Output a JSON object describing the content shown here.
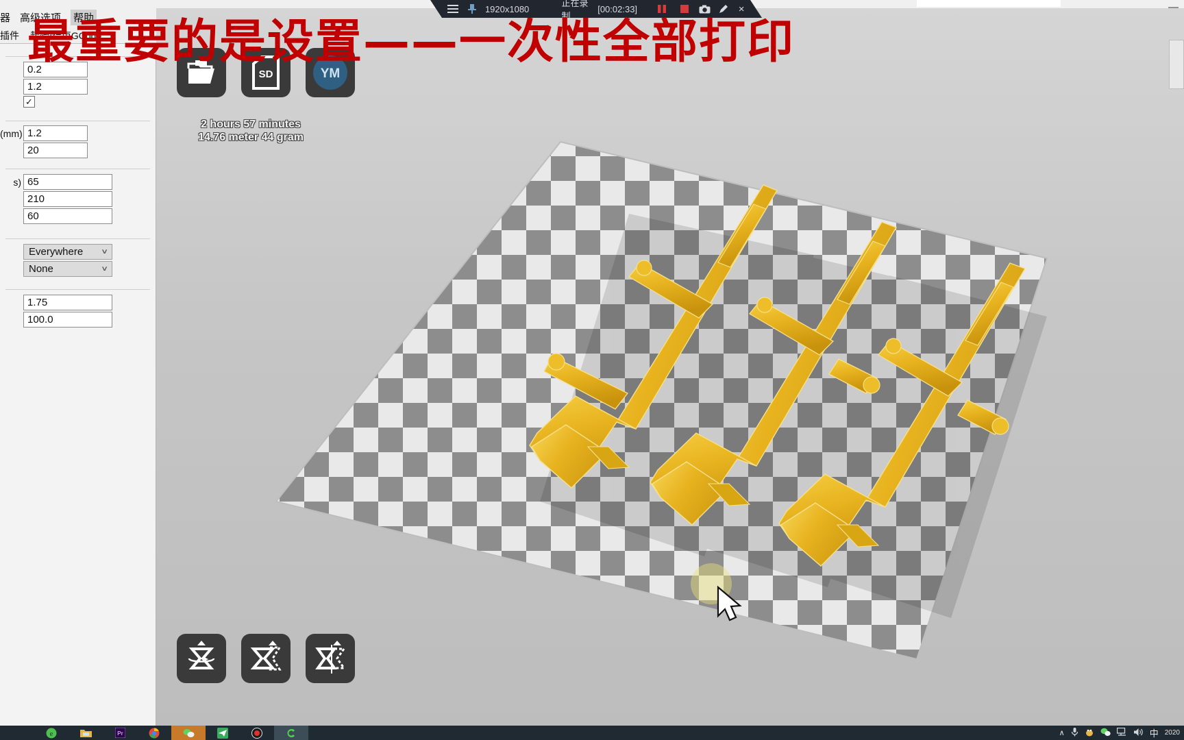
{
  "app": {
    "name": "Cura",
    "menu": [
      "器",
      "高级选项",
      "帮助"
    ],
    "tabs": [
      "插件",
      "起始/结束GCode"
    ]
  },
  "settings": {
    "quality": {
      "rows": [
        {
          "label": "",
          "value": "0.2",
          "type": "text"
        },
        {
          "label": "",
          "value": "1.2",
          "type": "text"
        },
        {
          "label": "",
          "value": "",
          "type": "checkbox",
          "checked": true
        }
      ]
    },
    "fill": {
      "rows": [
        {
          "label": "(mm)",
          "value": "1.2",
          "type": "text"
        },
        {
          "label": "",
          "value": "20",
          "type": "text"
        }
      ]
    },
    "speed": {
      "rows": [
        {
          "label": "s)",
          "value": "65",
          "type": "text"
        },
        {
          "label": "",
          "value": "210",
          "type": "text"
        },
        {
          "label": "",
          "value": "60",
          "type": "text"
        }
      ]
    },
    "support": {
      "rows": [
        {
          "label": "",
          "value": "Everywhere",
          "type": "select"
        },
        {
          "label": "",
          "value": "None",
          "type": "select"
        }
      ]
    },
    "filament": {
      "rows": [
        {
          "label": "",
          "value": "1.75",
          "type": "text"
        },
        {
          "label": "",
          "value": "100.0",
          "type": "text"
        }
      ]
    }
  },
  "viewport": {
    "tool_icons": [
      {
        "name": "load-model-icon",
        "label": "Load"
      },
      {
        "name": "sd-card-icon",
        "label": "SD"
      },
      {
        "name": "youmagine-icon",
        "label": "YM"
      }
    ],
    "print_info": {
      "time": "2 hours 57 minutes",
      "material": "14.76 meter 44 gram"
    },
    "view_icons": [
      {
        "name": "rotate-icon",
        "label": "Rotate"
      },
      {
        "name": "scale-icon",
        "label": "Scale"
      },
      {
        "name": "mirror-icon",
        "label": "Mirror"
      }
    ],
    "models": {
      "count": 3,
      "color": "#e8b31f",
      "description": "three yellow rifle models on checkered build plate"
    }
  },
  "recorder": {
    "menu_icon": "hamburger-icon",
    "pin_icon": "pin-icon",
    "resolution": "1920x1080",
    "status": "正在录制",
    "timer": "[00:02:33]",
    "buttons": [
      {
        "name": "pause-button",
        "label": "‖"
      },
      {
        "name": "stop-button",
        "label": "■"
      },
      {
        "name": "screenshot-button",
        "label": "camera"
      },
      {
        "name": "draw-button",
        "label": "pencil"
      },
      {
        "name": "close-button",
        "label": "×"
      }
    ],
    "accent": "#d63a3a"
  },
  "annotation": {
    "text": "最重要的是设置——一次性全部打印",
    "color": "#c00000"
  },
  "taskbar": {
    "apps": [
      {
        "name": "edge-icon",
        "color": "#4fbf52",
        "label": "e"
      },
      {
        "name": "file-explorer-icon",
        "color": "#e8b54d",
        "label": ""
      },
      {
        "name": "premiere-icon",
        "color": "#9b59d0",
        "label": "Pr"
      },
      {
        "name": "chrome-icon",
        "color": "#e8453c",
        "label": ""
      },
      {
        "name": "wechat-icon",
        "color": "#4caf50",
        "label": ""
      },
      {
        "name": "telegram-icon",
        "color": "#4caf50",
        "label": ""
      },
      {
        "name": "recorder-icon",
        "color": "#e03030",
        "label": ""
      },
      {
        "name": "cura-icon",
        "color": "#4fd04f",
        "label": "C"
      }
    ],
    "tray": [
      "chevron-up-icon",
      "microphone-icon",
      "qq-icon",
      "wechat-tray-icon",
      "network-icon",
      "volume-icon"
    ],
    "ime": "中",
    "date": "2020"
  },
  "window": {
    "minimize": "—"
  }
}
